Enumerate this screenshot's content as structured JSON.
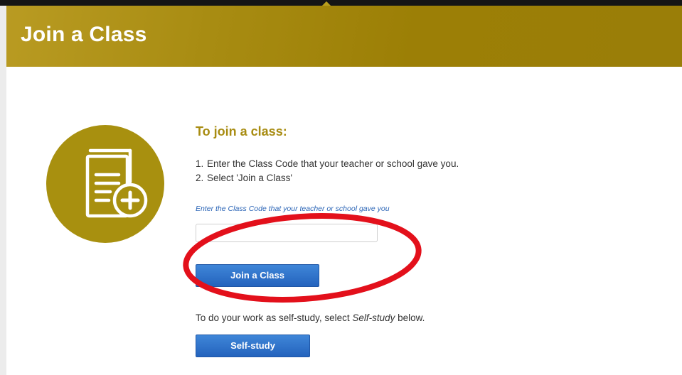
{
  "header": {
    "title": "Join a Class"
  },
  "main": {
    "heading": "To join a class:",
    "steps": [
      {
        "num": "1.",
        "text": "Enter the Class Code that your teacher or school gave you."
      },
      {
        "num": "2.",
        "text": "Select 'Join a Class'"
      }
    ],
    "class_code": {
      "label": "Enter the Class Code that your teacher or school gave you",
      "value": "",
      "placeholder": ""
    },
    "join_button_label": "Join a Class",
    "selfstudy": {
      "prefix": "To do your work as self-study, select ",
      "emphasis": "Self-study",
      "suffix": " below."
    },
    "selfstudy_button_label": "Self-study"
  },
  "colors": {
    "banner_gold": "#a88c12",
    "heading_gold": "#a88c12",
    "button_blue": "#2f72c9",
    "annotation_red": "#e3101b"
  },
  "icons": {
    "class_icon": "book-add-icon",
    "annotation": "red-ellipse-annotation"
  }
}
